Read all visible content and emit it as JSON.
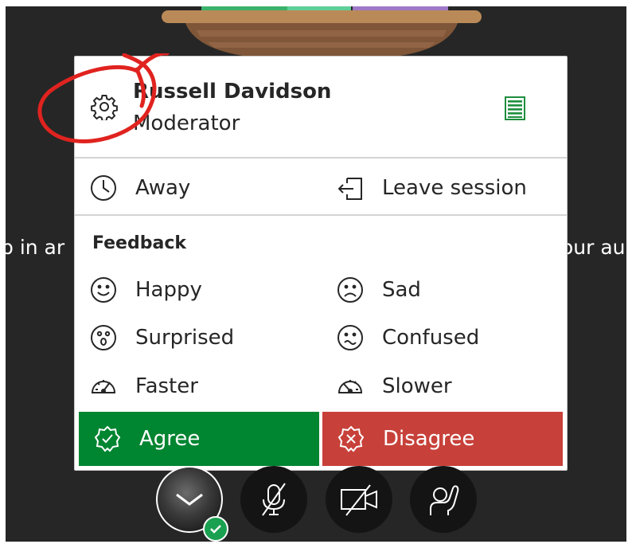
{
  "background": {
    "text_left": "p in ar",
    "text_right": "our au"
  },
  "user": {
    "name": "Russell Davidson",
    "role": "Moderator"
  },
  "status": {
    "away_label": "Away",
    "leave_label": "Leave session"
  },
  "feedback": {
    "title": "Feedback",
    "items": [
      {
        "label": "Happy",
        "icon": "happy-face-icon"
      },
      {
        "label": "Sad",
        "icon": "sad-face-icon"
      },
      {
        "label": "Surprised",
        "icon": "surprised-face-icon"
      },
      {
        "label": "Confused",
        "icon": "confused-face-icon"
      },
      {
        "label": "Faster",
        "icon": "speedometer-fast-icon"
      },
      {
        "label": "Slower",
        "icon": "speedometer-slow-icon"
      }
    ],
    "agree_label": "Agree",
    "disagree_label": "Disagree"
  },
  "colors": {
    "agree": "#008531",
    "disagree": "#c7413a",
    "list_icon": "#1e8e3e",
    "annotation": "#e0231f"
  },
  "controls": [
    "avatar-menu-toggle",
    "microphone-muted",
    "camera-off",
    "raise-hand"
  ]
}
